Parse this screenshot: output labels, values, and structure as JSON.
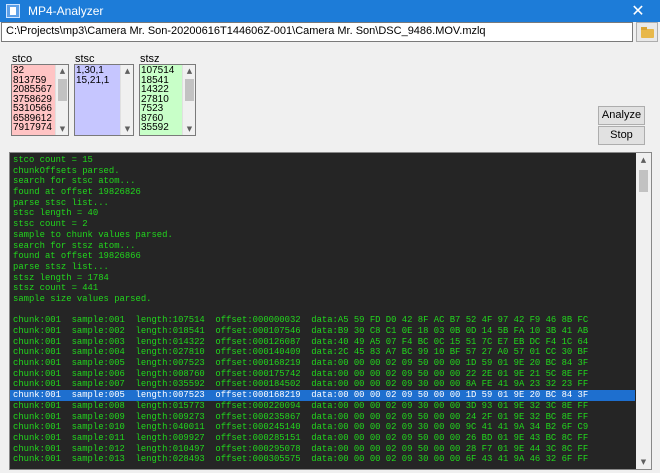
{
  "window": {
    "title": "MP4-Analyzer",
    "close_glyph": "✕"
  },
  "path": {
    "value": "C:\\Projects\\mp3\\Camera Mr. Son-20200616T144606Z-001\\Camera Mr. Son\\DSC_9486.MOV.mzlq",
    "browse_icon": "folder-icon"
  },
  "lists": {
    "stco": {
      "label": "stco",
      "color": "#ffc4c4",
      "items": [
        "32",
        "813759",
        "2085567",
        "3758629",
        "5310566",
        "6589612",
        "7917974"
      ]
    },
    "stsc": {
      "label": "stsc",
      "color": "#c6c6ff",
      "items": [
        "1,30,1",
        "15,21,1"
      ]
    },
    "stsz": {
      "label": "stsz",
      "color": "#c8ffc8",
      "items": [
        "107514",
        "18541",
        "14322",
        "27810",
        "7523",
        "8760",
        "35592"
      ]
    },
    "scroll_up": "▲",
    "scroll_down": "▼"
  },
  "buttons": {
    "analyze": "Analyze",
    "stop": "Stop"
  },
  "console": {
    "text_color": "#22d61d",
    "selected_index": 22,
    "lines": [
      "stco count = 15",
      "chunkOffsets parsed.",
      "search for stsc atom...",
      "found at offset 19826826",
      "parse stsc list...",
      "stsc length = 40",
      "stsc count = 2",
      "sample to chunk values parsed.",
      "search for stsz atom...",
      "found at offset 19826866",
      "parse stsz list...",
      "stsz length = 1784",
      "stsz count = 441",
      "sample size values parsed.",
      "",
      "chunk:001  sample:001  length:107514  offset:000000032  data:A5 59 FD D0 42 8F AC B7 52 4F 97 42 F9 46 8B FC",
      "chunk:001  sample:002  length:018541  offset:000107546  data:B9 30 C8 C1 0E 18 03 0B 0D 14 5B FA 10 3B 41 AB",
      "chunk:001  sample:003  length:014322  offset:000126087  data:40 49 A5 07 F4 BC 0C 15 51 7C E7 EB DC F4 1C 64",
      "chunk:001  sample:004  length:027810  offset:000140409  data:2C 45 83 A7 BC 99 10 BF 57 27 A0 57 01 CC 30 BF",
      "chunk:001  sample:005  length:007523  offset:000168219  data:00 00 00 02 09 50 00 00 1D 59 01 9E 20 BC 84 3F",
      "chunk:001  sample:006  length:008760  offset:000175742  data:00 00 00 02 09 50 00 00 22 2E 01 9E 21 5C 8E FF",
      "chunk:001  sample:007  length:035592  offset:000184502  data:00 00 00 02 09 30 00 00 8A FE 41 9A 23 32 23 FF",
      "chunk:001  sample:005  length:007523  offset:000168219  data:00 00 00 02 09 50 00 00 1D 59 01 9E 20 BC 84 3F",
      "chunk:001  sample:008  length:015773  offset:000220094  data:00 00 00 02 09 30 00 00 3D 93 01 9E 32 3C 8E FF",
      "chunk:001  sample:009  length:009273  offset:000235867  data:00 00 00 02 09 50 00 00 24 2F 01 9E 32 BC 8E FF",
      "chunk:001  sample:010  length:040011  offset:000245140  data:00 00 00 02 09 30 00 00 9C 41 41 9A 34 B2 6F C9",
      "chunk:001  sample:011  length:009927  offset:000285151  data:00 00 00 02 09 50 00 00 26 BD 01 9E 43 BC 8C FF",
      "chunk:001  sample:012  length:010497  offset:000295078  data:00 00 00 02 09 50 00 00 28 F7 01 9E 44 3C 8C FF",
      "chunk:001  sample:013  length:028493  offset:000305575  data:00 00 00 02 09 30 00 00 6F 43 41 9A 46 32 6F FF"
    ]
  }
}
